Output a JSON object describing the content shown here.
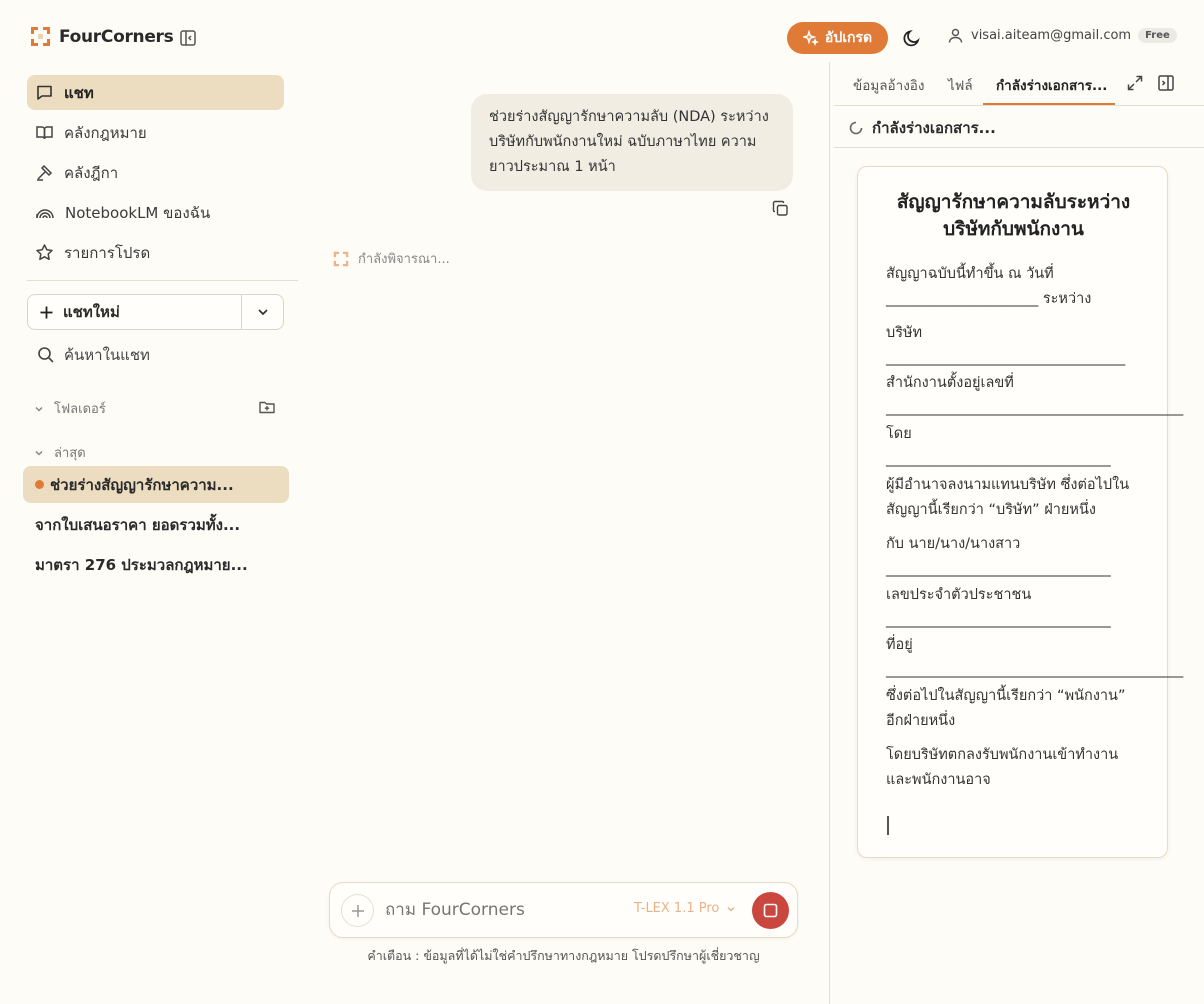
{
  "header": {
    "brand": "FourCorners",
    "upgrade_label": "อัปเกรด",
    "account_email": "visai.aiteam@gmail.com",
    "plan_badge": "Free"
  },
  "sidebar": {
    "nav": [
      {
        "label": "แชท",
        "icon": "chat-icon",
        "active": true
      },
      {
        "label": "คลังกฎหมาย",
        "icon": "book-icon"
      },
      {
        "label": "คลังฎีกา",
        "icon": "gavel-icon"
      },
      {
        "label": "NotebookLM ของฉัน",
        "icon": "notebook-icon"
      },
      {
        "label": "รายการโปรด",
        "icon": "star-icon"
      }
    ],
    "new_chat_label": "แชทใหม่",
    "search_label": "ค้นหาในแชท",
    "folders_label": "โฟลเดอร์",
    "recent_label": "ล่าสุด",
    "recent": [
      {
        "title": "ช่วยร่างสัญญารักษาความ...",
        "active": true
      },
      {
        "title": "จากใบเสนอราคา ยอดรวมทั้ง..."
      },
      {
        "title": "มาตรา 276 ประมวลกฎหมาย..."
      }
    ]
  },
  "chat": {
    "user_message": [
      "ช่วยร่างสัญญารักษาความลับ (NDA) ระหว่าง",
      "บริษัทกับพนักงานใหม่ ฉบับภาษาไทย ความ",
      "ยาวประมาณ 1 หน้า"
    ],
    "thinking_label": "กำลังพิจารณา...",
    "input_placeholder": "ถาม FourCorners",
    "model_label": "T-LEX 1.1 Pro",
    "disclaimer": "คำเตือน : ข้อมูลที่ได้ไม่ใช่คำปรึกษาทางกฎหมาย โปรดปรึกษาผู้เชี่ยวชาญ"
  },
  "panel": {
    "tabs": [
      "ข้อมูลอ้างอิง",
      "ไฟล์",
      "กำลังร่างเอกสาร..."
    ],
    "status": "กำลังร่างเอกสาร...",
    "document": {
      "title_lines": [
        "สัญญารักษาความลับระหว่าง",
        "บริษัทกับพนักงาน"
      ],
      "lines": [
        "สัญญาฉบับนี้ทำขึ้น ณ วันที่",
        "_____________________ ระหว่าง",
        "บริษัท",
        "_________________________________",
        "สำนักงานตั้งอยู่เลขที่",
        "_________________________________________",
        "โดย",
        "_______________________________",
        "ผู้มีอำนาจลงนามแทนบริษัท ซึ่งต่อไปใน",
        "สัญญานี้เรียกว่า “บริษัท” ฝ่ายหนึ่ง",
        "กับ นาย/นาง/นางสาว",
        "_______________________________",
        "เลขประจำตัวประชาชน",
        "_______________________________",
        "ที่อยู่",
        "_________________________________________",
        "ซึ่งต่อไปในสัญญานี้เรียกว่า “พนักงาน”",
        "อีกฝ่ายหนึ่ง",
        "โดยบริษัทตกลงรับพนักงานเข้าทำงาน",
        "และพนักงานอาจ"
      ]
    }
  },
  "colors": {
    "accent": "#e07a37",
    "active_bg": "#ecdcc0",
    "stop": "#c9473e",
    "background": "#fdfcf6"
  }
}
